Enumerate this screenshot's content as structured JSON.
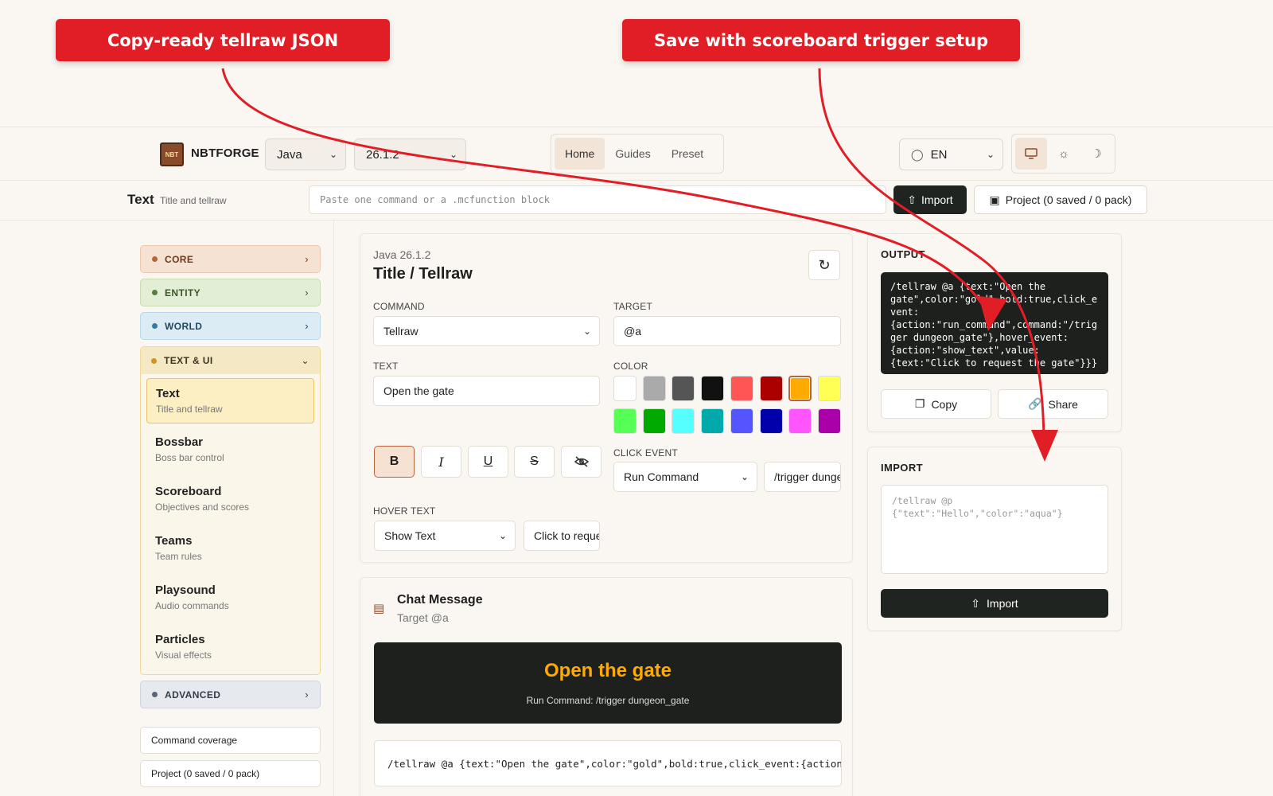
{
  "annotations": {
    "left_banner": "Copy-ready tellraw JSON",
    "right_banner": "Save with scoreboard trigger setup"
  },
  "header": {
    "logo_badge": "NBT",
    "brand": "NBTFORGE",
    "edition": "Java",
    "version": "26.1.2",
    "nav": [
      "Home",
      "Guides",
      "Preset"
    ],
    "language": "EN"
  },
  "subbar": {
    "title": "Text",
    "subtitle": "Title and tellraw",
    "command_placeholder": "Paste one command or a .mcfunction block",
    "import_label": "Import",
    "project_label": "Project (0 saved / 0 pack)"
  },
  "sidebar": {
    "categories": {
      "core": "CORE",
      "entity": "ENTITY",
      "world": "WORLD",
      "text_ui": "TEXT & UI",
      "advanced": "ADVANCED"
    },
    "items": [
      {
        "title": "Text",
        "desc": "Title and tellraw"
      },
      {
        "title": "Bossbar",
        "desc": "Boss bar control"
      },
      {
        "title": "Scoreboard",
        "desc": "Objectives and scores"
      },
      {
        "title": "Teams",
        "desc": "Team rules"
      },
      {
        "title": "Playsound",
        "desc": "Audio commands"
      },
      {
        "title": "Particles",
        "desc": "Visual effects"
      }
    ],
    "coverage": "Command coverage",
    "project": "Project (0 saved / 0 pack)"
  },
  "editor": {
    "version_label": "Java 26.1.2",
    "title": "Title / Tellraw",
    "command_label": "COMMAND",
    "command_value": "Tellraw",
    "target_label": "TARGET",
    "target_value": "@a",
    "text_label": "TEXT",
    "text_value": "Open the gate",
    "color_label": "COLOR",
    "colors": [
      "#ffffff",
      "#aaaaaa",
      "#555555",
      "#111111",
      "#ff5555",
      "#aa0000",
      "#ffaa00",
      "#ffff55",
      "#55ff55",
      "#00aa00",
      "#55ffff",
      "#00aaaa",
      "#5555ff",
      "#0000aa",
      "#ff55ff",
      "#aa00aa"
    ],
    "selected_color": "#ffaa00",
    "click_label": "CLICK EVENT",
    "click_action": "Run Command",
    "click_value": "/trigger dungeon_gate",
    "hover_label": "HOVER TEXT",
    "hover_action": "Show Text",
    "hover_value": "Click to request the gate"
  },
  "chat": {
    "title": "Chat Message",
    "subtitle": "Target @a",
    "preview_text": "Open the gate",
    "preview_color": "#ffaa00",
    "preview_sub": "Run Command: /trigger dungeon_gate",
    "command": "/tellraw @a {text:\"Open the gate\",color:\"gold\",bold:true,click_event:{action:\"run_command\",command:\"/trigger dungeon_gate\"}}"
  },
  "output": {
    "title": "OUTPUT",
    "code": "/tellraw @a {text:\"Open the\ngate\",color:\"gold\",bold:true,click_e\nvent:\n{action:\"run_command\",command:\"/trig\nger dungeon_gate\"},hover_event:\n{action:\"show_text\",value:\n{text:\"Click to request the gate\"}}}",
    "copy": "Copy",
    "share": "Share"
  },
  "import_panel": {
    "title": "IMPORT",
    "placeholder": "/tellraw @p\n{\"text\":\"Hello\",\"color\":\"aqua\"}",
    "button": "Import"
  }
}
